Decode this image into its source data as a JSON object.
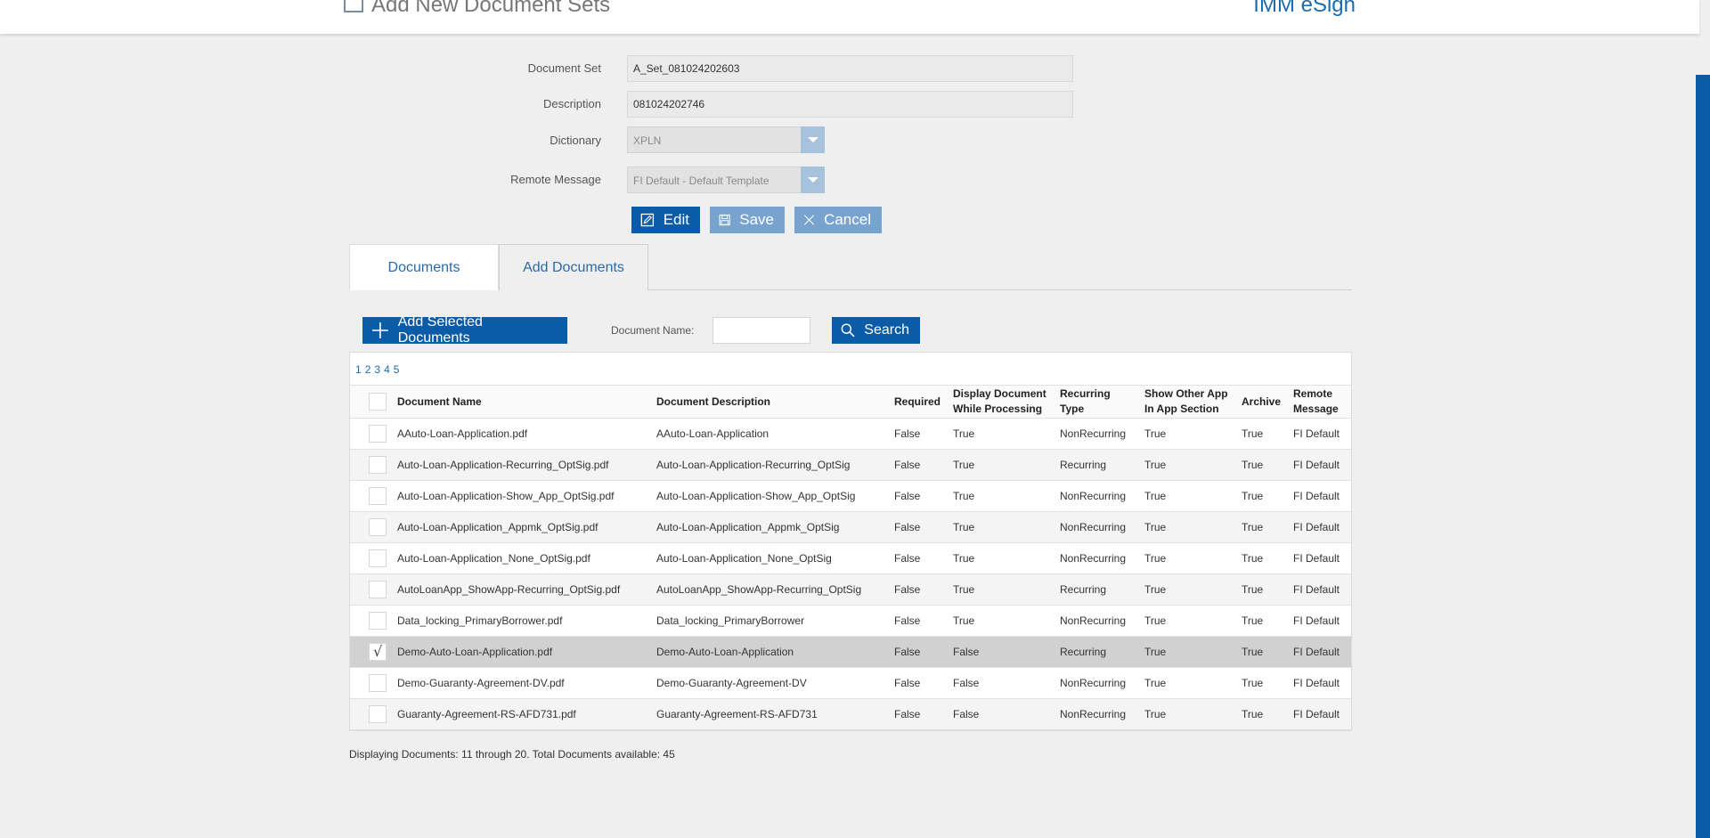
{
  "header": {
    "title": "Add New Document Sets",
    "brand": "IMM eSign"
  },
  "form": {
    "document_set_label": "Document Set",
    "document_set_value": "A_Set_081024202603",
    "description_label": "Description",
    "description_value": "081024202746",
    "dictionary_label": "Dictionary",
    "dictionary_value": "XPLN",
    "remote_message_label": "Remote Message",
    "remote_message_value": "FI Default - Default Template"
  },
  "actions": {
    "edit": "Edit",
    "save": "Save",
    "cancel": "Cancel"
  },
  "tabs": [
    {
      "label": "Documents"
    },
    {
      "label": "Add Documents"
    }
  ],
  "toolbar": {
    "add_selected": "Add Selected Documents",
    "document_name_label": "Document Name:",
    "document_name_value": "",
    "search": "Search"
  },
  "pager": [
    "1",
    "2",
    "3",
    "4",
    "5"
  ],
  "table": {
    "headers": {
      "name": "Document Name",
      "desc": "Document Description",
      "req": "Required",
      "disp_1": "Display Document",
      "disp_2": "While Processing",
      "rec_1": "Recurring",
      "rec_2": "Type",
      "show_1": "Show Other App",
      "show_2": "In App Section",
      "arch": "Archive",
      "rm_1": "Remote",
      "rm_2": "Message"
    },
    "rows": [
      {
        "checked": false,
        "name": "AAuto-Loan-Application.pdf",
        "desc": "AAuto-Loan-Application",
        "req": "False",
        "disp": "True",
        "rec": "NonRecurring",
        "show": "True",
        "arch": "True",
        "rm": "FI Default"
      },
      {
        "checked": false,
        "name": "Auto-Loan-Application-Recurring_OptSig.pdf",
        "desc": "Auto-Loan-Application-Recurring_OptSig",
        "req": "False",
        "disp": "True",
        "rec": "Recurring",
        "show": "True",
        "arch": "True",
        "rm": "FI Default"
      },
      {
        "checked": false,
        "name": "Auto-Loan-Application-Show_App_OptSig.pdf",
        "desc": "Auto-Loan-Application-Show_App_OptSig",
        "req": "False",
        "disp": "True",
        "rec": "NonRecurring",
        "show": "True",
        "arch": "True",
        "rm": "FI Default"
      },
      {
        "checked": false,
        "name": "Auto-Loan-Application_Appmk_OptSig.pdf",
        "desc": "Auto-Loan-Application_Appmk_OptSig",
        "req": "False",
        "disp": "True",
        "rec": "NonRecurring",
        "show": "True",
        "arch": "True",
        "rm": "FI Default"
      },
      {
        "checked": false,
        "name": "Auto-Loan-Application_None_OptSig.pdf",
        "desc": "Auto-Loan-Application_None_OptSig",
        "req": "False",
        "disp": "True",
        "rec": "NonRecurring",
        "show": "True",
        "arch": "True",
        "rm": "FI Default"
      },
      {
        "checked": false,
        "name": "AutoLoanApp_ShowApp-Recurring_OptSig.pdf",
        "desc": "AutoLoanApp_ShowApp-Recurring_OptSig",
        "req": "False",
        "disp": "True",
        "rec": "Recurring",
        "show": "True",
        "arch": "True",
        "rm": "FI Default"
      },
      {
        "checked": false,
        "name": "Data_locking_PrimaryBorrower.pdf",
        "desc": "Data_locking_PrimaryBorrower",
        "req": "False",
        "disp": "True",
        "rec": "NonRecurring",
        "show": "True",
        "arch": "True",
        "rm": "FI Default"
      },
      {
        "checked": true,
        "name": "Demo-Auto-Loan-Application.pdf",
        "desc": "Demo-Auto-Loan-Application",
        "req": "False",
        "disp": "False",
        "rec": "Recurring",
        "show": "True",
        "arch": "True",
        "rm": "FI Default"
      },
      {
        "checked": false,
        "name": "Demo-Guaranty-Agreement-DV.pdf",
        "desc": "Demo-Guaranty-Agreement-DV",
        "req": "False",
        "disp": "False",
        "rec": "NonRecurring",
        "show": "True",
        "arch": "True",
        "rm": "FI Default"
      },
      {
        "checked": false,
        "name": "Guaranty-Agreement-RS-AFD731.pdf",
        "desc": "Guaranty-Agreement-RS-AFD731",
        "req": "False",
        "disp": "False",
        "rec": "NonRecurring",
        "show": "True",
        "arch": "True",
        "rm": "FI Default"
      }
    ]
  },
  "footer": {
    "summary": "Displaying Documents: 11 through 20. Total Documents available: 45"
  },
  "colors": {
    "primary": "#0a5ca8",
    "disabled": "#79a3cf",
    "link": "#1a6cb0",
    "selected_row": "#d1d1d1"
  }
}
